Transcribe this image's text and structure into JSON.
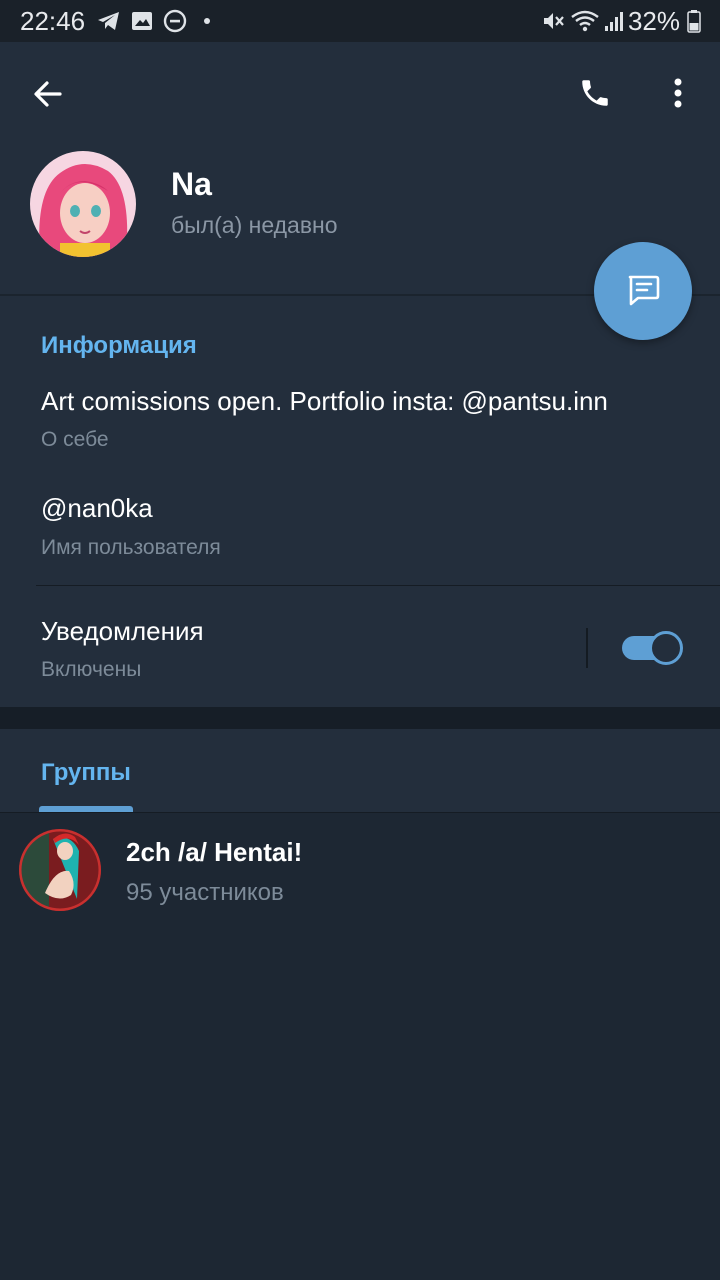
{
  "status_bar": {
    "time": "22:46",
    "battery": "32%",
    "icons": [
      "telegram-icon",
      "image-icon",
      "dnd-icon",
      "dot-icon",
      "mute-icon",
      "wifi-icon",
      "signal-icon",
      "battery-icon"
    ]
  },
  "header": {
    "name": "Na",
    "last_seen": "был(а) недавно",
    "icons": [
      "back-arrow-icon",
      "phone-icon",
      "more-vert-icon",
      "message-icon"
    ]
  },
  "info": {
    "section_title": "Информация",
    "bio": "Art comissions open. Portfolio insta: @pantsu.inn",
    "bio_label": "О себе",
    "username": "@nan0ka",
    "username_label": "Имя пользователя",
    "notifications": "Уведомления",
    "notifications_state": "Включены",
    "notifications_on": true
  },
  "groups": {
    "tab_label": "Группы",
    "items": [
      {
        "name": "2ch /a/ Hentai!",
        "members": "95 участников"
      }
    ]
  },
  "colors": {
    "accent": "#5e9fd4",
    "section_title": "#64b5ef",
    "header_bg": "#232e3c",
    "body_bg": "#1d2733"
  }
}
